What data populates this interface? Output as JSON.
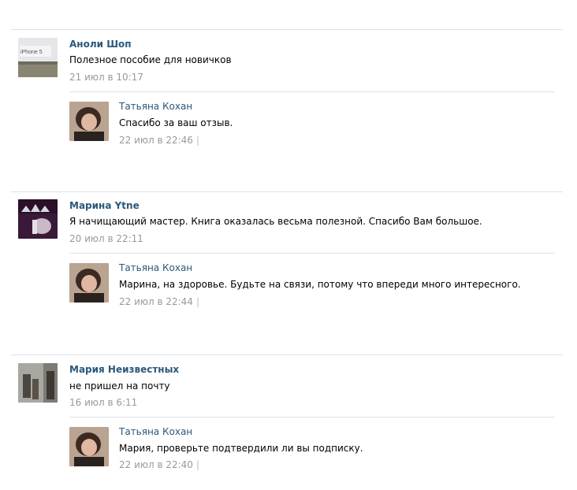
{
  "comments": [
    {
      "author": "Аноли Шоп",
      "text": "Полезное пособие для новичков",
      "date": "21 июл в 10:17",
      "avatar_caption": "iPhone 5",
      "reply": {
        "author": "Татьяна Кохан",
        "text": "Спасибо за ваш отзыв.",
        "date": "22 июл в 22:46",
        "separator": "|"
      }
    },
    {
      "author": "Марина Ytne",
      "text": "Я начищающий мастер. Книга оказалась весьма полезной. Спасибо Вам большое.",
      "date": "20 июл в 22:11",
      "reply": {
        "author": "Татьяна Кохан",
        "text": "Марина, на здоровье. Будьте на связи, потому что впереди много интересного.",
        "date": "22 июл в 22:44",
        "separator": "|"
      }
    },
    {
      "author": "Мария Неизвестных",
      "text": "не пришел на почту",
      "date": "16 июл в 6:11",
      "reply": {
        "author": "Татьяна Кохан",
        "text": "Мария, проверьте подтвердили ли вы подписку.",
        "date": "22 июл в 22:40",
        "separator": "|"
      }
    }
  ],
  "colors": {
    "link": "#2b587a",
    "date": "#999999",
    "separator": "#dde1e6"
  }
}
